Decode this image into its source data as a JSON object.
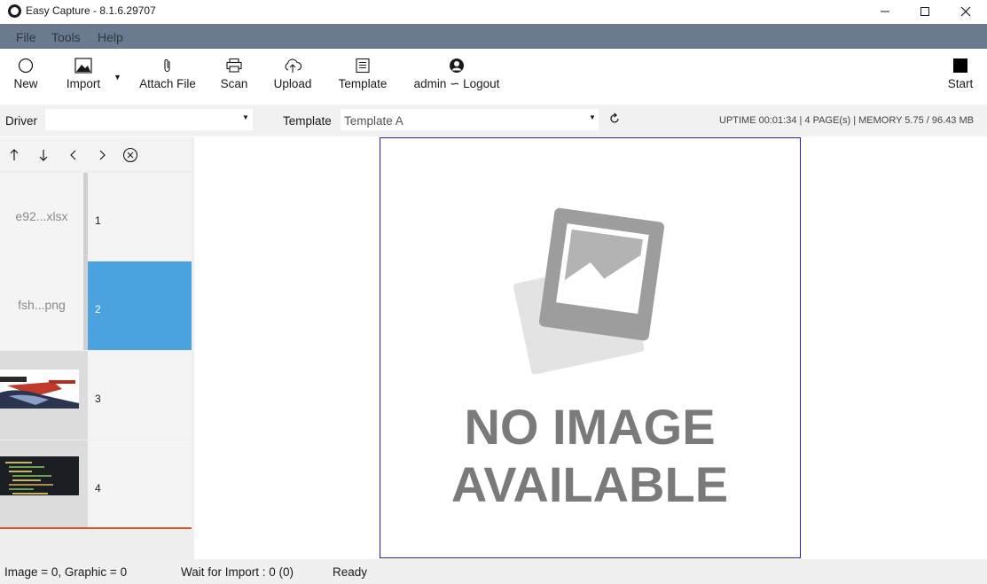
{
  "window": {
    "title": "Easy Capture - 8.1.6.29707"
  },
  "menu": {
    "items": [
      "File",
      "Tools",
      "Help"
    ]
  },
  "toolbar": {
    "new_label": "New",
    "import_label": "Import",
    "attach_label": "Attach File",
    "scan_label": "Scan",
    "upload_label": "Upload",
    "template_label": "Template",
    "user_label": "admin ∽ Logout",
    "start_label": "Start"
  },
  "options": {
    "driver_label": "Driver",
    "driver_value": "",
    "template_label": "Template",
    "template_value": "Template A",
    "status_info": "UPTIME  00:01:34  |  4 PAGE(s)  |  MEMORY 5.75 / 96.43 MB"
  },
  "pages": [
    {
      "name": "e92...xlsx",
      "number": "1",
      "selected": false
    },
    {
      "name": "fsh...png",
      "number": "2",
      "selected": true
    },
    {
      "name": "",
      "number": "3",
      "selected": false
    },
    {
      "name": "",
      "number": "4",
      "selected": false
    }
  ],
  "preview": {
    "placeholder_line1": "NO IMAGE",
    "placeholder_line2": "AVAILABLE"
  },
  "statusbar": {
    "image_info": "Image = 0, Graphic = 0",
    "wait_info": "Wait for Import : 0 (0)",
    "state": "Ready"
  },
  "colors": {
    "menubar": "#6b7b8f",
    "selection": "#4aa3df",
    "accent_underline": "#f07a1a",
    "list_end_line": "#d9541e",
    "preview_border": "#2a1fb0"
  }
}
